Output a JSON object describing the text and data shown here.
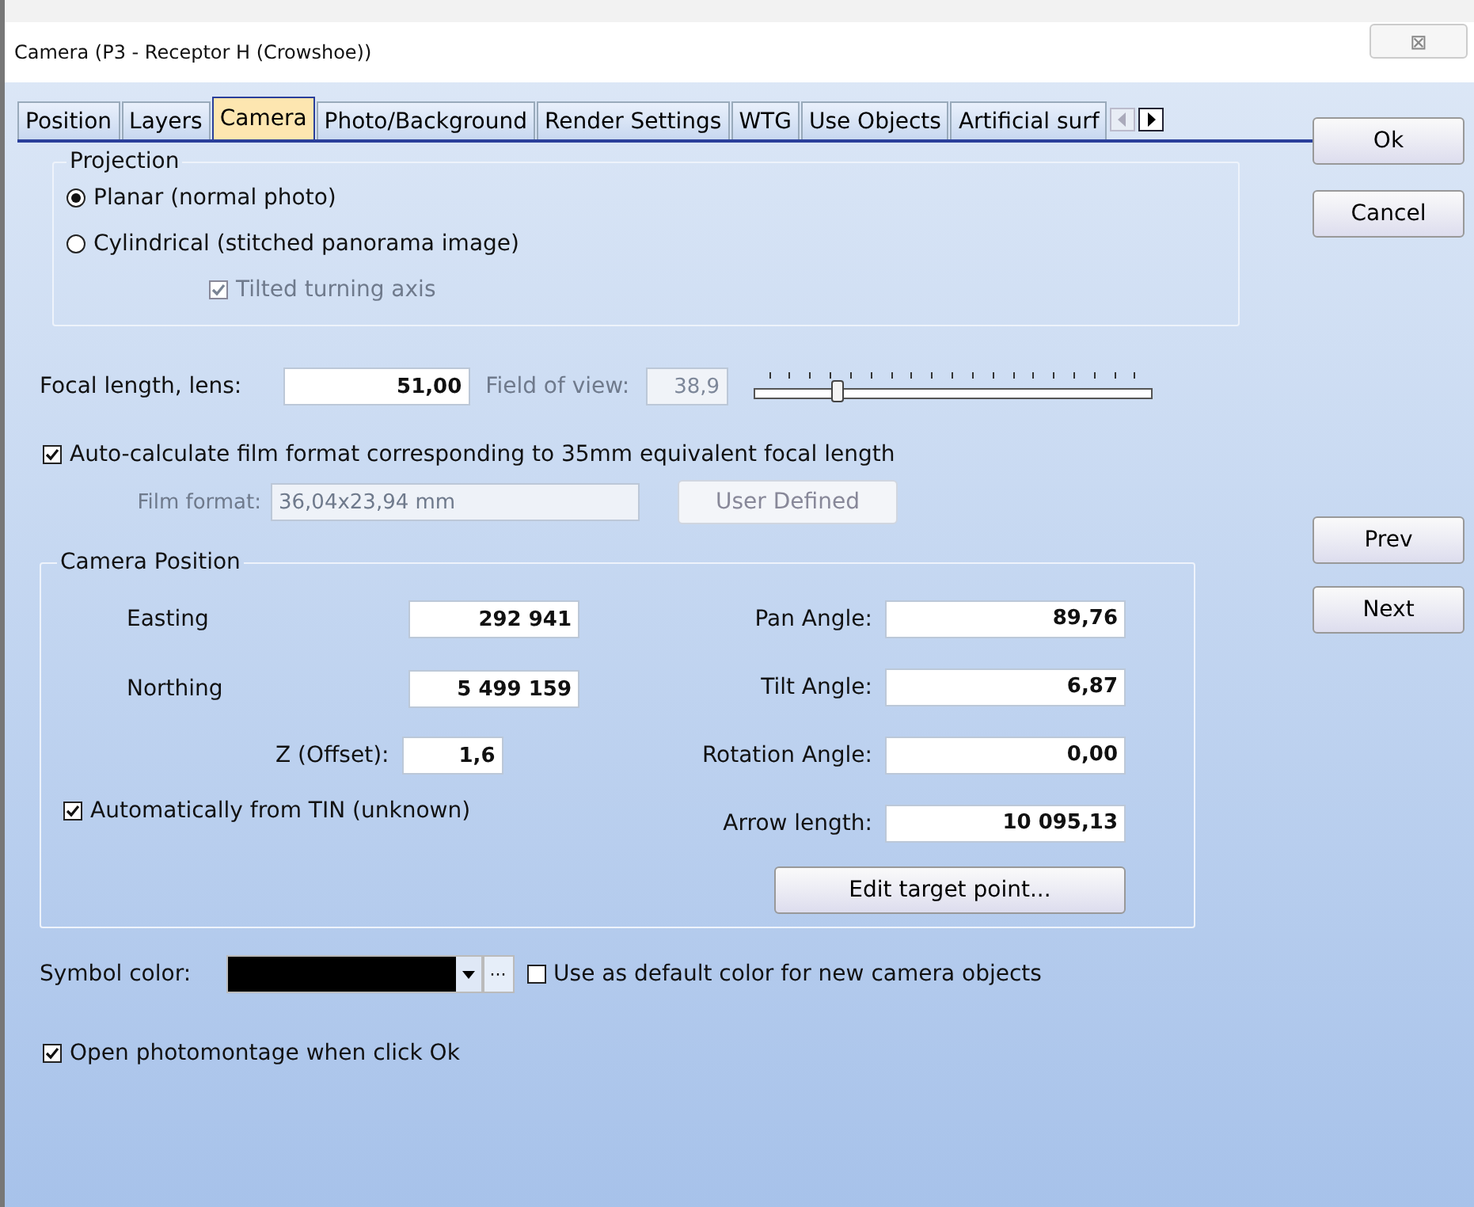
{
  "window": {
    "title": "Camera  (P3 - Receptor H (Crowshoe))",
    "close": "⊠"
  },
  "tabs": [
    {
      "label": "Position",
      "selected": false
    },
    {
      "label": "Layers",
      "selected": false
    },
    {
      "label": "Camera",
      "selected": true
    },
    {
      "label": "Photo/Background",
      "selected": false
    },
    {
      "label": "Render Settings",
      "selected": false
    },
    {
      "label": "WTG",
      "selected": false
    },
    {
      "label": "Use Objects",
      "selected": false
    },
    {
      "label": "Artificial surf",
      "selected": false
    }
  ],
  "side_buttons": [
    {
      "label": "Ok"
    },
    {
      "label": "Cancel"
    },
    {
      "label": "Prev"
    },
    {
      "label": "Next"
    }
  ],
  "projection": {
    "title": "Projection",
    "options": [
      {
        "label": "Planar (normal photo)",
        "selected": true
      },
      {
        "label": "Cylindrical (stitched panorama image)",
        "selected": false
      }
    ],
    "tilted_axis": {
      "label": "Tilted turning axis",
      "checked": true,
      "disabled": true
    }
  },
  "focal": {
    "label": "Focal length, lens:",
    "value": "51,00",
    "fov_label": "Field of view:",
    "fov_value": "38,9",
    "level": 0.21
  },
  "auto_film": {
    "label": "Auto-calculate film format corresponding to 35mm equivalent focal length",
    "checked": true
  },
  "film": {
    "label": "Film format:",
    "value": "36,04x23,94 mm",
    "button": "User Defined",
    "disabled": true
  },
  "camera_position": {
    "title": "Camera Position",
    "left": [
      {
        "label": "Easting",
        "value": "292 941"
      },
      {
        "label": "Northing",
        "value": "5 499 159"
      },
      {
        "label": "Z (Offset):",
        "value": "1,6"
      }
    ],
    "right": [
      {
        "label": "Pan Angle:",
        "value": "89,76"
      },
      {
        "label": "Tilt Angle:",
        "value": "6,87"
      },
      {
        "label": "Rotation Angle:",
        "value": "0,00"
      },
      {
        "label": "Arrow length:",
        "value": "10 095,13"
      }
    ],
    "auto_tin": {
      "label": "Automatically from TIN (unknown)",
      "checked": true
    },
    "button": "Edit target point..."
  },
  "symbol_color": {
    "label": "Symbol color:",
    "more": "···",
    "default_label": "Use as default color for new camera objects",
    "default_checked": false
  },
  "open_photomontage": {
    "label": "Open photomontage when click Ok",
    "checked": true
  }
}
